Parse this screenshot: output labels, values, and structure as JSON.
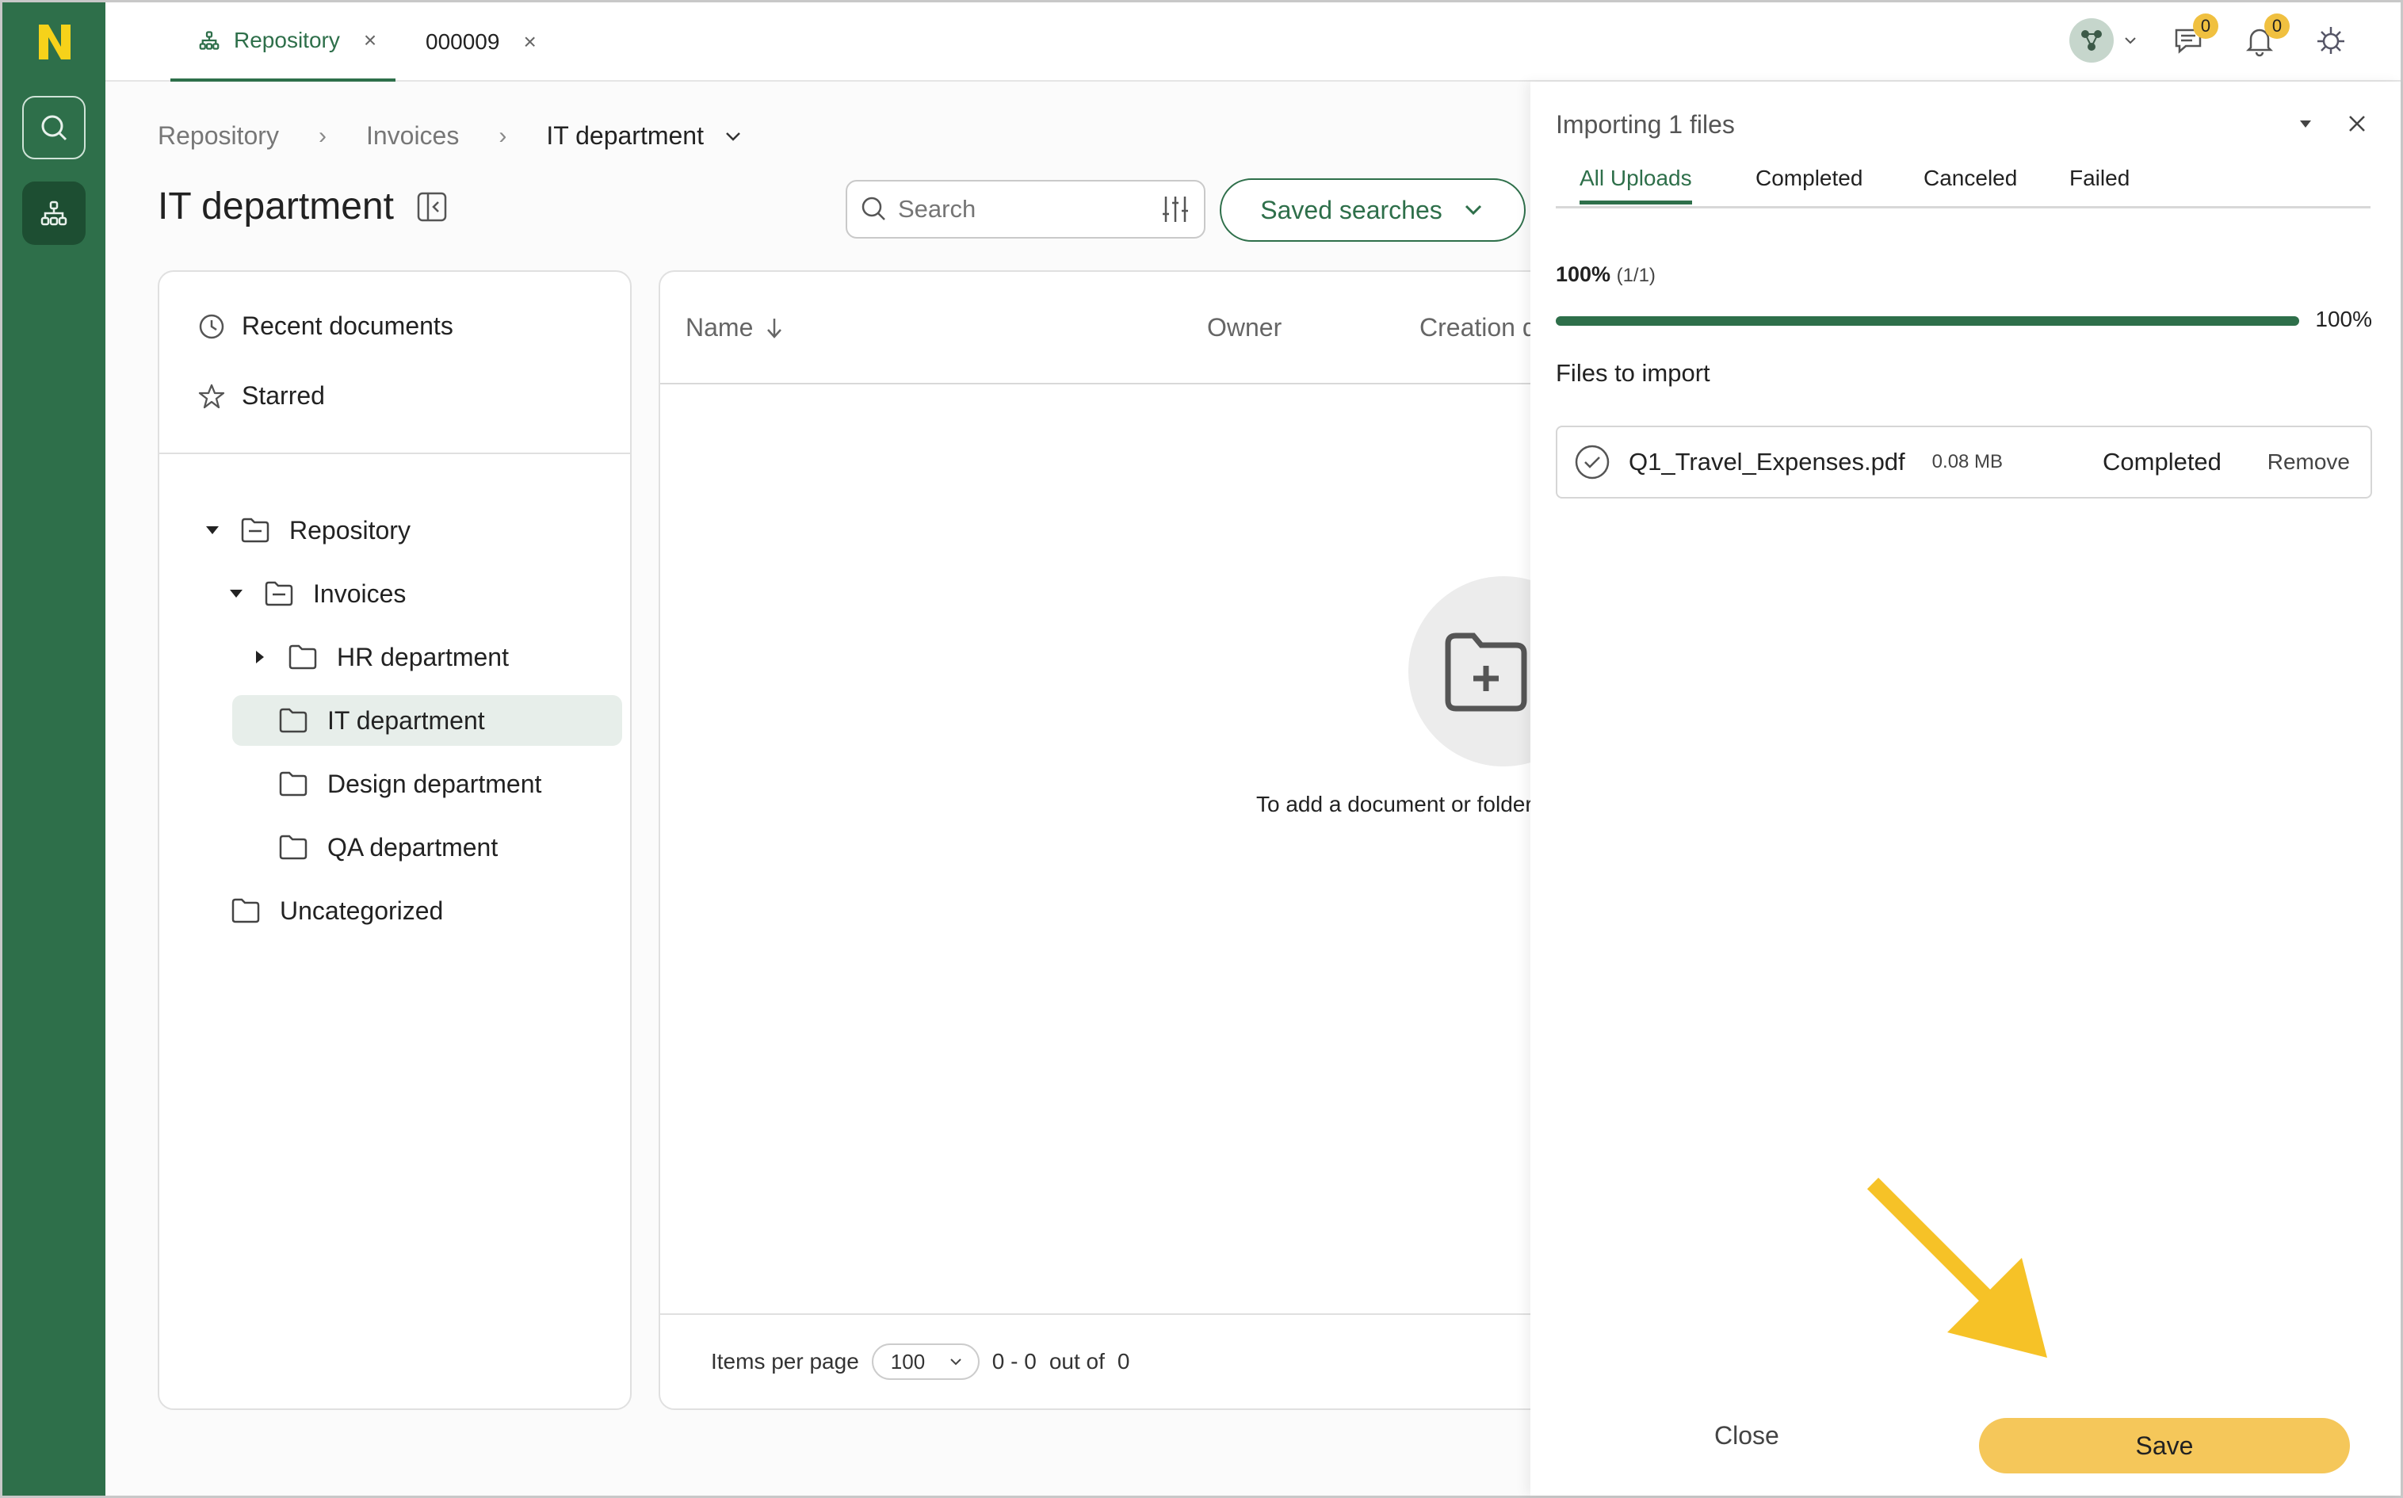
{
  "tabs": [
    {
      "label": "Repository",
      "close": "×"
    },
    {
      "label": "000009",
      "close": "×"
    }
  ],
  "header": {
    "messages_count": "0",
    "notifications_count": "0"
  },
  "breadcrumb": {
    "items": [
      "Repository",
      "Invoices",
      "IT department"
    ],
    "separator": "›"
  },
  "page": {
    "title": "IT department"
  },
  "search": {
    "placeholder": "Search",
    "saved_searches_label": "Saved searches"
  },
  "sidebar": {
    "quick": [
      {
        "label": "Recent documents",
        "icon": "clock-icon"
      },
      {
        "label": "Starred",
        "icon": "star-icon"
      }
    ],
    "tree": [
      {
        "label": "Repository",
        "expanded": true
      },
      {
        "label": "Invoices",
        "expanded": true
      },
      {
        "label": "HR department",
        "expanded": false
      },
      {
        "label": "IT department",
        "selected": true
      },
      {
        "label": "Design department"
      },
      {
        "label": "QA department"
      },
      {
        "label": "Uncategorized"
      }
    ]
  },
  "table": {
    "columns": [
      "Name",
      "Owner",
      "Creation d"
    ],
    "empty_text": "To add a document or folder",
    "footer": {
      "items_per_page_label": "Items per page",
      "items_per_page_value": "100",
      "range": "0 - 0",
      "out_of_label": "out of",
      "total": "0"
    }
  },
  "upload": {
    "title": "Importing 1 files",
    "tabs": [
      "All Uploads",
      "Completed",
      "Canceled",
      "Failed"
    ],
    "progress_pct_label": "100%",
    "progress_count": "(1/1)",
    "progress_right": "100%",
    "progress": 1.0,
    "files_label": "Files to import",
    "files": [
      {
        "name": "Q1_Travel_Expenses.pdf",
        "size": "0.08 MB",
        "status": "Completed",
        "action": "Remove"
      }
    ],
    "close_label": "Close",
    "save_label": "Save"
  },
  "colors": {
    "brand_green": "#2e6f4a",
    "accent_yellow": "#f5c75a",
    "arrow_yellow": "#f6c227"
  }
}
